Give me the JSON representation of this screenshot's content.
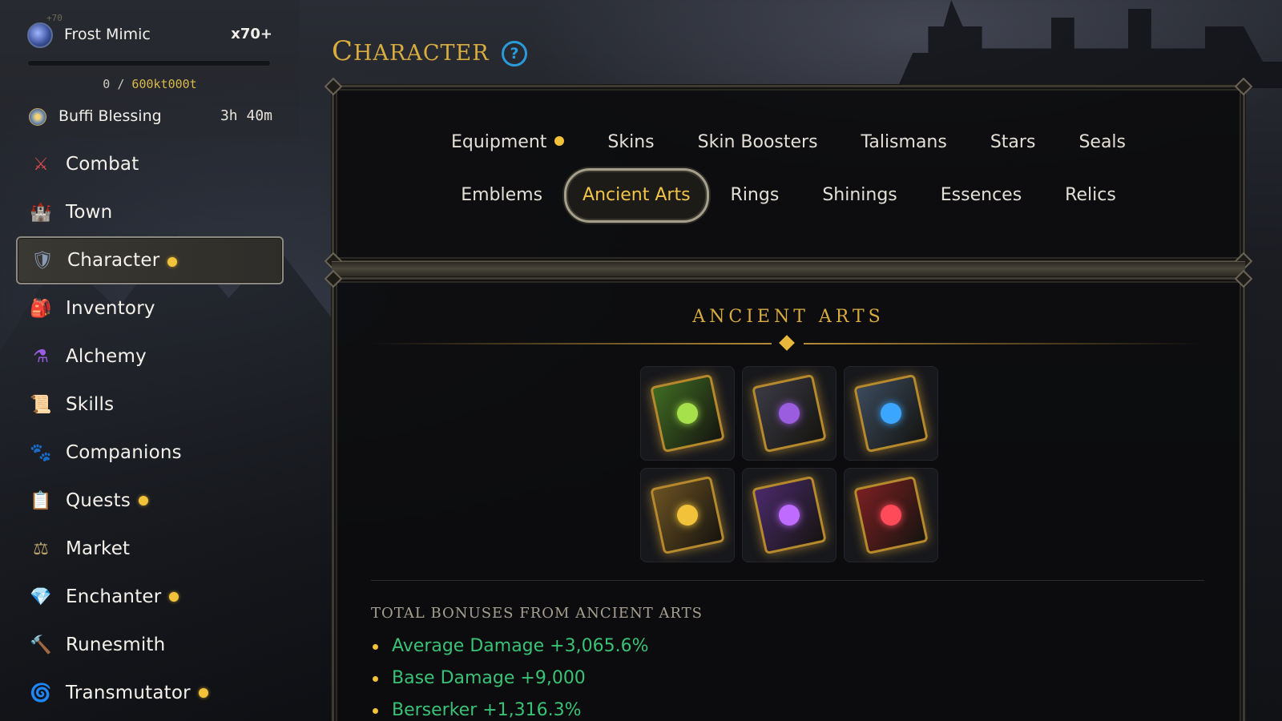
{
  "buff": {
    "sup": "+70",
    "name": "Frost Mimic",
    "multiplier": "x70+",
    "progress_current": "0",
    "progress_sep": " / ",
    "progress_max": "600kt000t",
    "progress_fraction": 0,
    "icon": "frost-mimic-icon"
  },
  "blessing": {
    "name": "Buffi Blessing",
    "time": "3h 40m",
    "icon": "blessing-icon"
  },
  "nav": [
    {
      "key": "combat",
      "label": "Combat",
      "icon": "⚔",
      "color": "#d94b4b",
      "dot": false
    },
    {
      "key": "town",
      "label": "Town",
      "icon": "🏰",
      "color": "#e0a640",
      "dot": false
    },
    {
      "key": "character",
      "label": "Character",
      "icon": "🛡",
      "color": "#8a9bb8",
      "dot": true,
      "active": true
    },
    {
      "key": "inventory",
      "label": "Inventory",
      "icon": "🎒",
      "color": "#b8773f",
      "dot": false
    },
    {
      "key": "alchemy",
      "label": "Alchemy",
      "icon": "⚗",
      "color": "#9b5de0",
      "dot": false
    },
    {
      "key": "skills",
      "label": "Skills",
      "icon": "📜",
      "color": "#caa34a",
      "dot": false
    },
    {
      "key": "companions",
      "label": "Companions",
      "icon": "🐾",
      "color": "#6fbf4a",
      "dot": false
    },
    {
      "key": "quests",
      "label": "Quests",
      "icon": "📋",
      "color": "#d9545a",
      "dot": true
    },
    {
      "key": "market",
      "label": "Market",
      "icon": "⚖",
      "color": "#b9a36b",
      "dot": false
    },
    {
      "key": "enchanter",
      "label": "Enchanter",
      "icon": "💎",
      "color": "#5cc8e0",
      "dot": true
    },
    {
      "key": "runesmith",
      "label": "Runesmith",
      "icon": "🔨",
      "color": "#d97a3a",
      "dot": false
    },
    {
      "key": "transmutator",
      "label": "Transmutator",
      "icon": "🌀",
      "color": "#5a8fe0",
      "dot": true
    }
  ],
  "header": {
    "title_cap": "C",
    "title_rest": "HARACTER",
    "help": "?"
  },
  "tabs_row1": [
    {
      "key": "equipment",
      "label": "Equipment",
      "dot": true
    },
    {
      "key": "skins",
      "label": "Skins"
    },
    {
      "key": "skin-boosters",
      "label": "Skin Boosters"
    },
    {
      "key": "talismans",
      "label": "Talismans"
    },
    {
      "key": "stars",
      "label": "Stars"
    },
    {
      "key": "seals",
      "label": "Seals"
    }
  ],
  "tabs_row2": [
    {
      "key": "emblems",
      "label": "Emblems"
    },
    {
      "key": "ancient-arts",
      "label": "Ancient Arts",
      "active": true
    },
    {
      "key": "rings",
      "label": "Rings"
    },
    {
      "key": "shinings",
      "label": "Shinings"
    },
    {
      "key": "essences",
      "label": "Essences"
    },
    {
      "key": "relics",
      "label": "Relics"
    }
  ],
  "section": {
    "title": "ANCIENT ARTS",
    "arts": [
      {
        "icon": "green-tree-book-icon",
        "cover": "#3f6b22",
        "gem": "#a6e04a"
      },
      {
        "icon": "dark-amethyst-book-icon",
        "cover": "#3b3a44",
        "gem": "#9b5de0"
      },
      {
        "icon": "blue-crystal-book-icon",
        "cover": "#3b4a5c",
        "gem": "#3ba6ff"
      },
      {
        "icon": "golden-sun-book-icon",
        "cover": "#6b5122",
        "gem": "#f2c23a"
      },
      {
        "icon": "purple-skull-book-icon",
        "cover": "#4a2a6b",
        "gem": "#c06bff"
      },
      {
        "icon": "crimson-heart-book-icon",
        "cover": "#7a1f22",
        "gem": "#ff4a5a"
      }
    ],
    "bonuses_heading": "TOTAL BONUSES FROM ANCIENT ARTS",
    "bonuses": [
      "Average Damage +3,065.6%",
      "Base Damage +9,000",
      "Berserker +1,316.3%"
    ]
  }
}
